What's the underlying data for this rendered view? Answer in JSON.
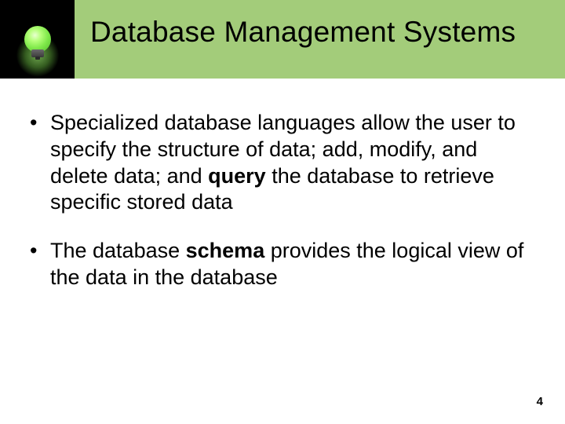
{
  "header": {
    "title": "Database Management Systems",
    "icon": "lightbulb-icon"
  },
  "bullets": [
    {
      "parts": [
        {
          "t": "Specialized database languages allow the user to specify the structure of data; add, modify, and delete data; and ",
          "b": false
        },
        {
          "t": "query",
          "b": true
        },
        {
          "t": " the database to retrieve specific stored data",
          "b": false
        }
      ]
    },
    {
      "parts": [
        {
          "t": "The database ",
          "b": false
        },
        {
          "t": "schema",
          "b": true
        },
        {
          "t": " provides the logical view of the data in the database",
          "b": false
        }
      ]
    }
  ],
  "page_number": "4"
}
